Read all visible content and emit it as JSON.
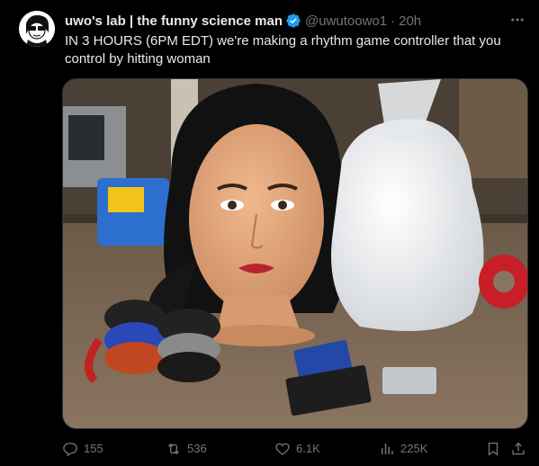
{
  "author": {
    "display_name": "uwo's lab | the funny science man",
    "handle": "@uwutoowo1",
    "separator": "·",
    "time": "20h",
    "verified": true
  },
  "tweet": {
    "text": "IN 3 HOURS (6PM EDT) we're making a rhythm game controller that you control by hitting woman"
  },
  "media": {
    "type": "photo"
  },
  "actions": {
    "replies": "155",
    "reposts": "536",
    "likes": "6.1K",
    "views": "225K"
  },
  "icons": {
    "reply": "reply-icon",
    "repost": "repost-icon",
    "like": "heart-icon",
    "views": "views-icon",
    "bookmark": "bookmark-icon",
    "share": "share-icon",
    "more": "more-icon",
    "verified": "verified-badge-icon"
  },
  "colors": {
    "background": "#000000",
    "text": "#e7e9ea",
    "secondary": "#71767b",
    "verified": "#1d9bf0"
  }
}
